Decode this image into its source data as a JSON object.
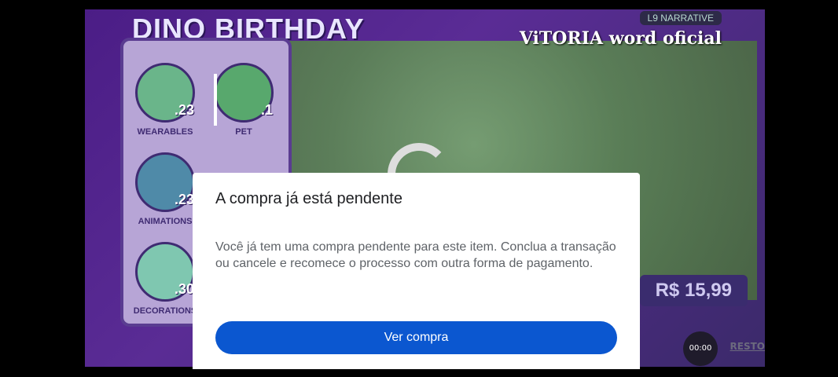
{
  "game": {
    "title": "DINO BIRTHDAY",
    "narrative_tag": "L9 NARRATIVE",
    "price": "R$ 15,99",
    "timer": "00:00",
    "restore_label": "RESTO",
    "categories": [
      {
        "label": "WEARABLES",
        "count": ".23"
      },
      {
        "label": "PET",
        "count": ".1"
      },
      {
        "label": "ANIMATIONS",
        "count": ".23"
      },
      {
        "label": "DECORATIONS",
        "count": ".30"
      }
    ]
  },
  "watermark": "ViTORIA word oficial",
  "dialog": {
    "title": "A compra já está pendente",
    "body": "Você já tem uma compra pendente para este item. Conclua a transação ou cancele e recomece o processo com outra forma de pagamento.",
    "primary_button": "Ver compra"
  }
}
